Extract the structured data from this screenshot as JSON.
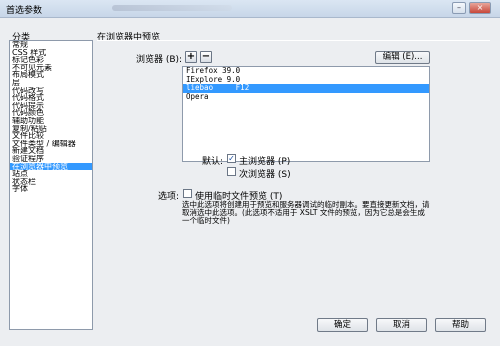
{
  "window": {
    "title": "首选参数"
  },
  "categories": {
    "header": "分类",
    "items": [
      "常规",
      "CSS 样式",
      "标记色彩",
      "不可见元素",
      "布局模式",
      "层",
      "代码改写",
      "代码格式",
      "代码提示",
      "代码颜色",
      "辅助功能",
      "复制/粘贴",
      "文件比较",
      "文件类型 / 编辑器",
      "新建文档",
      "验证程序",
      "在浏览器中预览",
      "站点",
      "状态栏",
      "字体"
    ],
    "selected_index": 16
  },
  "panel": {
    "title": "在浏览器中预览",
    "browsers_label": "浏览器 (B):",
    "add_symbol": "+",
    "remove_symbol": "−",
    "edit_button": "编辑 (E)...",
    "browsers": [
      "Firefox 39.0",
      "IExplore 9.0",
      "liebao     F12",
      "Opera"
    ],
    "selected_browser_index": 2,
    "default_label": "默认:",
    "primary_browser": {
      "label": "主浏览器 (P)",
      "checked": true
    },
    "secondary_browser": {
      "label": "次浏览器 (S)",
      "checked": false
    },
    "options_label": "选项:",
    "temp_file": {
      "label": "使用临时文件预览 (T)",
      "checked": false
    },
    "description": "选中此选项将创建用于预览和服务器调试的临时副本。要直接更新文档，请取消选中此选项。(此选项不适用于 XSLT 文件的预览，因为它总是会生成一个临时文件)"
  },
  "footer": {
    "ok": "确定",
    "cancel": "取消",
    "help": "帮助"
  },
  "colors": {
    "selection": "#3399ff",
    "window_bg": "#eceef1"
  }
}
